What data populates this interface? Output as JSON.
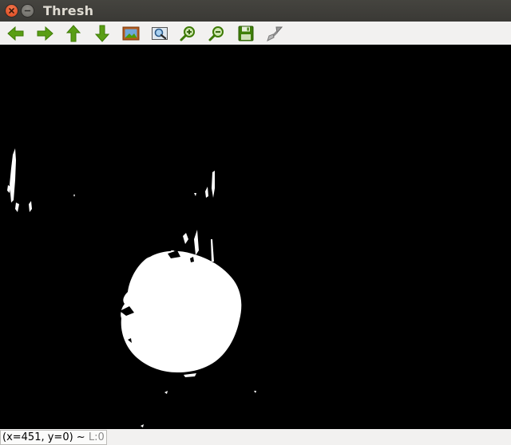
{
  "window": {
    "title": "Thresh"
  },
  "toolbar": {
    "buttons": [
      {
        "name": "pan-left-button",
        "icon": "arrow-left-icon"
      },
      {
        "name": "pan-right-button",
        "icon": "arrow-right-icon"
      },
      {
        "name": "pan-up-button",
        "icon": "arrow-up-icon"
      },
      {
        "name": "pan-down-button",
        "icon": "arrow-down-icon"
      },
      {
        "name": "zoom-original-button",
        "icon": "image-icon"
      },
      {
        "name": "zoom-fit-button",
        "icon": "zoom-fit-icon"
      },
      {
        "name": "zoom-in-button",
        "icon": "zoom-in-icon"
      },
      {
        "name": "zoom-out-button",
        "icon": "zoom-out-icon"
      },
      {
        "name": "save-button",
        "icon": "floppy-icon"
      },
      {
        "name": "properties-button",
        "icon": "brush-icon"
      }
    ]
  },
  "status": {
    "coords": "(x=451, y=0) ~ ",
    "level": "L:0"
  },
  "colors": {
    "arrow": "#4e9a06",
    "titlebar": "#3c3b37",
    "canvas": "#000000",
    "blob": "#ffffff"
  }
}
